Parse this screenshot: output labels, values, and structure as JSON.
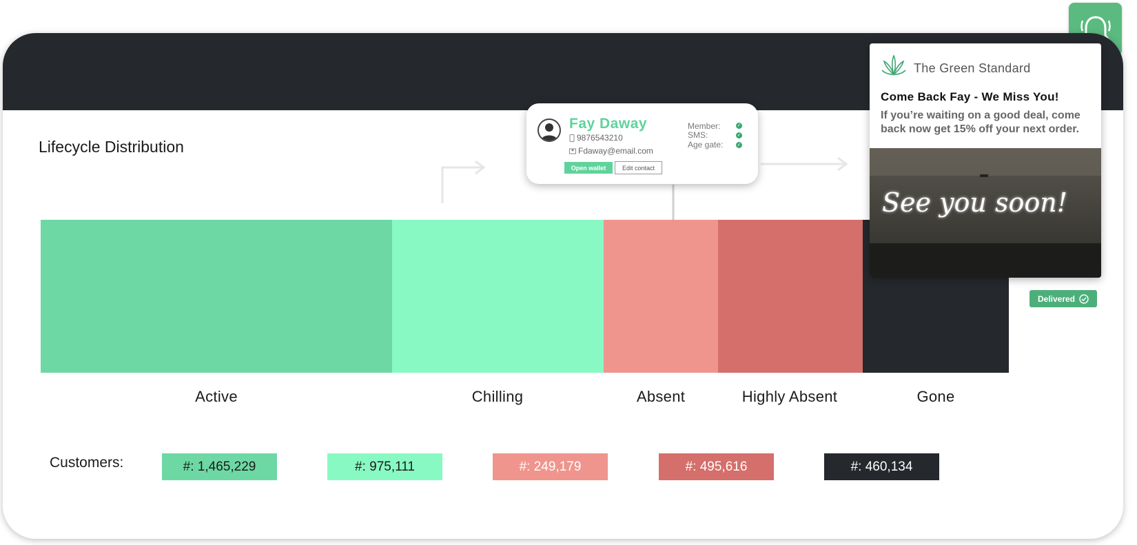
{
  "header": {
    "section_title": "Lifecycle Distribution"
  },
  "colors": {
    "active": "#6ed8a4",
    "chilling": "#89f9c3",
    "absent": "#ef958d",
    "highly_absent": "#d46f6b",
    "gone": "#25282d",
    "accent": "#5bba7f"
  },
  "chart_data": {
    "type": "bar",
    "orientation": "horizontal-stacked",
    "categories": [
      "Active",
      "Chilling",
      "Absent",
      "Highly Absent",
      "Gone"
    ],
    "values": [
      1465229,
      975111,
      249179,
      495616,
      460134
    ],
    "title": "Lifecycle Distribution"
  },
  "stages": [
    {
      "label": "Active",
      "count": "#: 1,465,229"
    },
    {
      "label": "Chilling",
      "count": "#: 975,111"
    },
    {
      "label": "Absent",
      "count": "#: 249,179"
    },
    {
      "label": "Highly Absent",
      "count": "#: 495,616"
    },
    {
      "label": "Gone",
      "count": "#: 460,134"
    }
  ],
  "customers_label": "Customers:",
  "contact": {
    "name": "Fay Daway",
    "phone": "9876543210",
    "email": "Fdaway@email.com",
    "member_label": "Member:",
    "sms_label": "SMS:",
    "age_gate_label": "Age gate:",
    "open_wallet": "Open wallet",
    "edit_contact": "Edit contact",
    "avatar_icon": "user-avatar-icon",
    "phone_icon": "phone-icon",
    "email_icon": "contact-icon"
  },
  "notification": {
    "brand": "The Green Standard",
    "title": "Come Back Fay - We Miss You!",
    "body": "If you’re waiting on a good deal, come back now get 15% off your next order.",
    "image_text": "See you soon!",
    "delivered": "Delivered",
    "bell_icon": "bell-icon",
    "brand_icon": "leaf-logo-icon",
    "delivered_icon": "check-circle-icon"
  }
}
